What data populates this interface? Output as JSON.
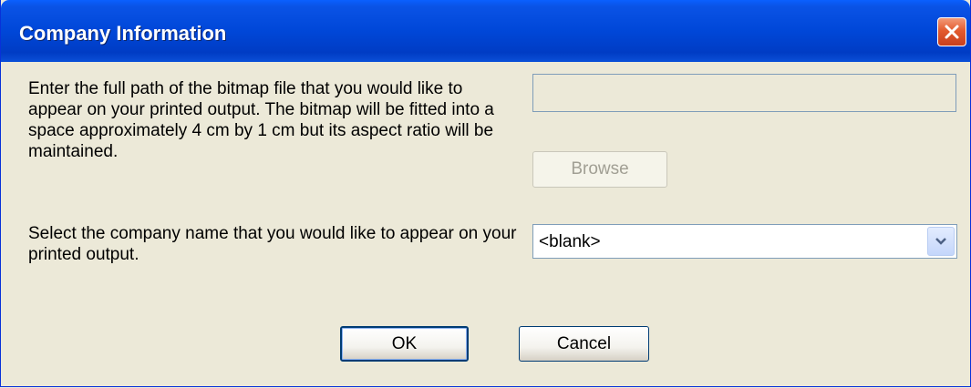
{
  "window": {
    "title": "Company Information"
  },
  "bitmap": {
    "description": "Enter the full path of the bitmap file that you would like to appear on your printed output.  The bitmap will be fitted into a space approximately 4 cm by 1 cm but its aspect ratio will be maintained.",
    "path_value": "",
    "browse_label": "Browse"
  },
  "company": {
    "description": "Select the company name that you would like to appear on your printed output.",
    "selected_value": "<blank>"
  },
  "buttons": {
    "ok_label": "OK",
    "cancel_label": "Cancel"
  },
  "colors": {
    "title_bar": "#0047d8",
    "close_button": "#e35b2f",
    "dialog_background": "#ece9d8"
  },
  "icons": {
    "close": "close-icon",
    "dropdown": "chevron-down-icon"
  }
}
